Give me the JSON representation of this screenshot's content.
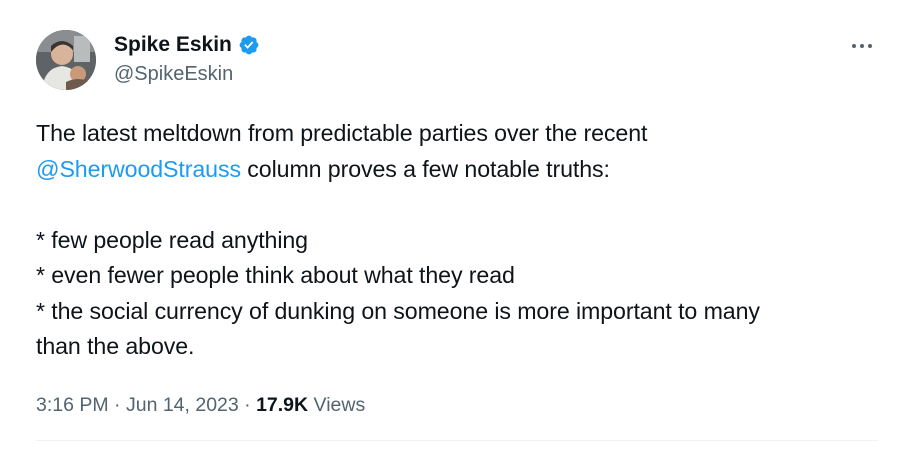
{
  "author": {
    "display_name": "Spike Eskin",
    "handle": "@SpikeEskin",
    "verified_badge_icon": "verified-badge-icon",
    "badge_color": "#1d9bf0"
  },
  "more_options_icon": "more-horizontal-icon",
  "tweet": {
    "line1": "The latest meltdown from predictable parties over the recent",
    "mention": "@SherwoodStrauss",
    "line2_rest": " column proves a few notable truths:",
    "bullet1": "* few people read anything",
    "bullet2": "* even fewer people think about what they read",
    "bullet3_line1": "* the social currency of dunking on someone is more important to many",
    "bullet3_line2": "than the above."
  },
  "meta": {
    "time": "3:16 PM",
    "separator": " · ",
    "date": "Jun 14, 2023",
    "views_count": "17.9K",
    "views_label": " Views"
  },
  "colors": {
    "text": "#0f1419",
    "secondary": "#536471",
    "link": "#1d9bf0",
    "divider": "#eff3f4"
  }
}
